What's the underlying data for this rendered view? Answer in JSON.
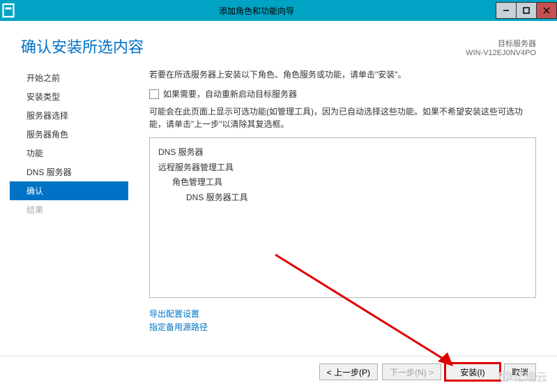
{
  "window": {
    "title": "添加角色和功能向导"
  },
  "header": {
    "title": "确认安装所选内容",
    "target_label": "目标服务器",
    "target_server": "WIN-V12EJ0NV4PO"
  },
  "sidebar": {
    "items": [
      {
        "label": "开始之前",
        "state": "normal"
      },
      {
        "label": "安装类型",
        "state": "normal"
      },
      {
        "label": "服务器选择",
        "state": "normal"
      },
      {
        "label": "服务器角色",
        "state": "normal"
      },
      {
        "label": "功能",
        "state": "normal"
      },
      {
        "label": "DNS 服务器",
        "state": "normal"
      },
      {
        "label": "确认",
        "state": "active"
      },
      {
        "label": "结果",
        "state": "disabled"
      }
    ]
  },
  "content": {
    "intro": "若要在所选服务器上安装以下角色、角色服务或功能，请单击\"安装\"。",
    "checkbox_label": "如果需要，自动重新启动目标服务器",
    "note": "可能会在此页面上显示可选功能(如管理工具)，因为已自动选择这些功能。如果不希望安装这些可选功能，请单击\"上一步\"以清除其复选框。",
    "list": [
      {
        "label": "DNS 服务器",
        "level": 0
      },
      {
        "label": "远程服务器管理工具",
        "level": 0
      },
      {
        "label": "角色管理工具",
        "level": 1
      },
      {
        "label": "DNS 服务器工具",
        "level": 2
      }
    ],
    "links": {
      "export": "导出配置设置",
      "altpath": "指定备用源路径"
    }
  },
  "footer": {
    "prev": "< 上一步(P)",
    "next": "下一步(N) >",
    "install": "安装(I)",
    "cancel": "取消"
  },
  "watermark": "亿速云"
}
